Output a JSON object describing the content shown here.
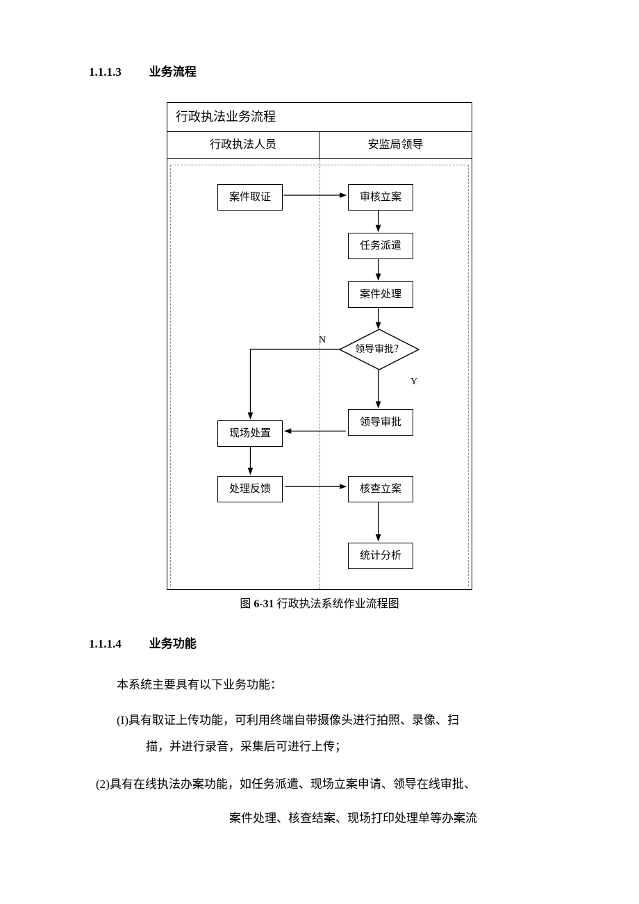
{
  "section1": {
    "number": "1.1.1.3",
    "title": "业务流程"
  },
  "flowchart": {
    "title": "行政执法业务流程",
    "lane_left": "行政执法人员",
    "lane_right": "安监局领导",
    "nodes": {
      "evidence": "案件取证",
      "review_file": "审核立案",
      "task_dispatch": "任务派遣",
      "case_handle": "案件处理",
      "decision": "领导审批？",
      "approval": "领导审批",
      "onsite": "现场处置",
      "feedback": "处理反馈",
      "close_case": "核查立案",
      "stats": "统计分析"
    },
    "labels": {
      "no": "N",
      "yes": "Y"
    }
  },
  "caption": {
    "prefix": "图",
    "number": "6-31",
    "text": "行政执法系统作业流程图"
  },
  "section2": {
    "number": "1.1.1.4",
    "title": "业务功能"
  },
  "para_intro": "本系统主要具有以下业务功能：",
  "item1_a": "(I)具有取证上传功能，可利用终端自带摄像头进行拍照、录像、扫",
  "item1_b": "描，并进行录音，采集后可进行上传；",
  "item2_a": "(2)具有在线执法办案功能，如任务派遣、现场立案申请、领导在线审批、",
  "item2_b": "案件处理、核查结案、现场打印处理单等办案流"
}
